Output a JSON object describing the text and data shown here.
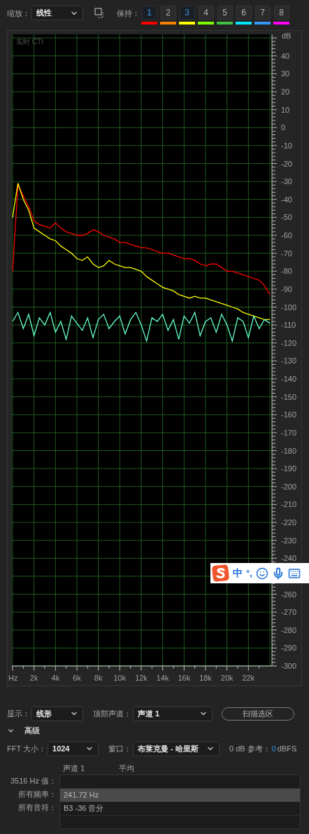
{
  "toolbar": {
    "zoom_label": "缩放：",
    "zoom_value": "线性",
    "hold_label": "保持：",
    "holds": [
      {
        "label": "1",
        "selected": true,
        "color": "#ff0000"
      },
      {
        "label": "2",
        "selected": false,
        "color": "#ff8000"
      },
      {
        "label": "3",
        "selected": true,
        "color": "#ffff00"
      },
      {
        "label": "4",
        "selected": false,
        "color": "#80ff00"
      },
      {
        "label": "5",
        "selected": false,
        "color": "#40c040"
      },
      {
        "label": "6",
        "selected": false,
        "color": "#00e5ff"
      },
      {
        "label": "7",
        "selected": false,
        "color": "#3399ff"
      },
      {
        "label": "8",
        "selected": false,
        "color": "#ff00ff"
      }
    ]
  },
  "spectrum": {
    "chart_data": {
      "type": "line",
      "title": "实时 CTI",
      "ylabel": "dB",
      "x": [
        0,
        500,
        1000,
        1500,
        2000,
        2500,
        3000,
        3500,
        4000,
        4500,
        5000,
        5500,
        6000,
        6500,
        7000,
        7500,
        8000,
        8500,
        9000,
        9500,
        10000,
        10500,
        11000,
        11500,
        12000,
        12500,
        13000,
        13500,
        14000,
        14500,
        15000,
        15500,
        16000,
        16500,
        17000,
        17500,
        18000,
        18500,
        19000,
        19500,
        20000,
        20500,
        21000,
        21500,
        22000,
        22500,
        23000,
        23500,
        24000
      ],
      "series": [
        {
          "color": "#ff0000",
          "values": [
            -80,
            -32,
            -38,
            -44,
            -52,
            -54,
            -55,
            -56,
            -53,
            -56,
            -58,
            -59,
            -60,
            -60,
            -59,
            -57,
            -58,
            -60,
            -61,
            -62,
            -64,
            -64,
            -65,
            -66,
            -67,
            -67,
            -68,
            -69,
            -70,
            -70,
            -71,
            -72,
            -73,
            -73,
            -74,
            -76,
            -77,
            -76,
            -76,
            -78,
            -80,
            -80,
            -81,
            -82,
            -83,
            -84,
            -85,
            -88,
            -93
          ]
        },
        {
          "color": "#ffff00",
          "values": [
            -50,
            -31,
            -40,
            -46,
            -56,
            -58,
            -60,
            -62,
            -63,
            -66,
            -68,
            -70,
            -73,
            -74,
            -72,
            -76,
            -78,
            -77,
            -74,
            -76,
            -77,
            -78,
            -78,
            -79,
            -80,
            -83,
            -85,
            -87,
            -89,
            -90,
            -91,
            -93,
            -94,
            -95,
            -94,
            -95,
            -95,
            -96,
            -97,
            -98,
            -99,
            -100,
            -101,
            -103,
            -104,
            -105,
            -106,
            -107,
            -107
          ]
        },
        {
          "color": "#66ffcc",
          "values": [
            -108,
            -103,
            -112,
            -104,
            -116,
            -106,
            -110,
            -103,
            -114,
            -108,
            -118,
            -105,
            -109,
            -113,
            -106,
            -117,
            -107,
            -104,
            -112,
            -108,
            -105,
            -115,
            -107,
            -103,
            -110,
            -119,
            -106,
            -108,
            -104,
            -113,
            -107,
            -118,
            -105,
            -109,
            -103,
            -116,
            -108,
            -106,
            -114,
            -104,
            -110,
            -119,
            -106,
            -108,
            -117,
            -105,
            -112,
            -107,
            -109
          ]
        }
      ],
      "xlim": [
        0,
        24000
      ],
      "ylim": [
        -300,
        52
      ],
      "grid": true,
      "xticks": [
        {
          "value": 0,
          "label": "Hz"
        },
        {
          "value": 2000,
          "label": "2k"
        },
        {
          "value": 4000,
          "label": "4k"
        },
        {
          "value": 6000,
          "label": "6k"
        },
        {
          "value": 8000,
          "label": "8k"
        },
        {
          "value": 10000,
          "label": "10k"
        },
        {
          "value": 12000,
          "label": "12k"
        },
        {
          "value": 14000,
          "label": "14k"
        },
        {
          "value": 16000,
          "label": "16k"
        },
        {
          "value": 18000,
          "label": "18k"
        },
        {
          "value": 20000,
          "label": "20k"
        },
        {
          "value": 22000,
          "label": "22k"
        }
      ],
      "yticks": [
        40,
        30,
        20,
        10,
        0,
        -10,
        -20,
        -30,
        -40,
        -50,
        -60,
        -70,
        -80,
        -90,
        -100,
        -110,
        -120,
        -130,
        -140,
        -150,
        -160,
        -170,
        -180,
        -190,
        -200,
        -210,
        -220,
        -230,
        -240,
        -260,
        -270,
        -280,
        -290,
        -300
      ]
    }
  },
  "ime_bar": {
    "mode": "中",
    "punctuation": "°,"
  },
  "controls": {
    "display_label": "显示：",
    "display_value": "线形",
    "channel_label": "顶部声道：",
    "channel_value": "声道 1",
    "scan_button": "扫描选区"
  },
  "advanced": {
    "label": "高级",
    "expanded": true,
    "fft_label": "FFT 大小：",
    "fft_value": "1024",
    "window_label": "窗口：",
    "window_value": "布莱克曼 - 哈里斯",
    "reference_label": "0 dB 参考：",
    "reference_value": "0",
    "reference_unit": "dBFS"
  },
  "table": {
    "columns": [
      "声道 1",
      "平均"
    ],
    "rows": [
      {
        "label": "3516 Hz 值：",
        "selected": false
      },
      {
        "label": "所有频率：",
        "value": "241.72 Hz",
        "selected": true
      },
      {
        "label": "所有音符：",
        "value": "B3 -36 音分",
        "selected": false
      }
    ]
  }
}
